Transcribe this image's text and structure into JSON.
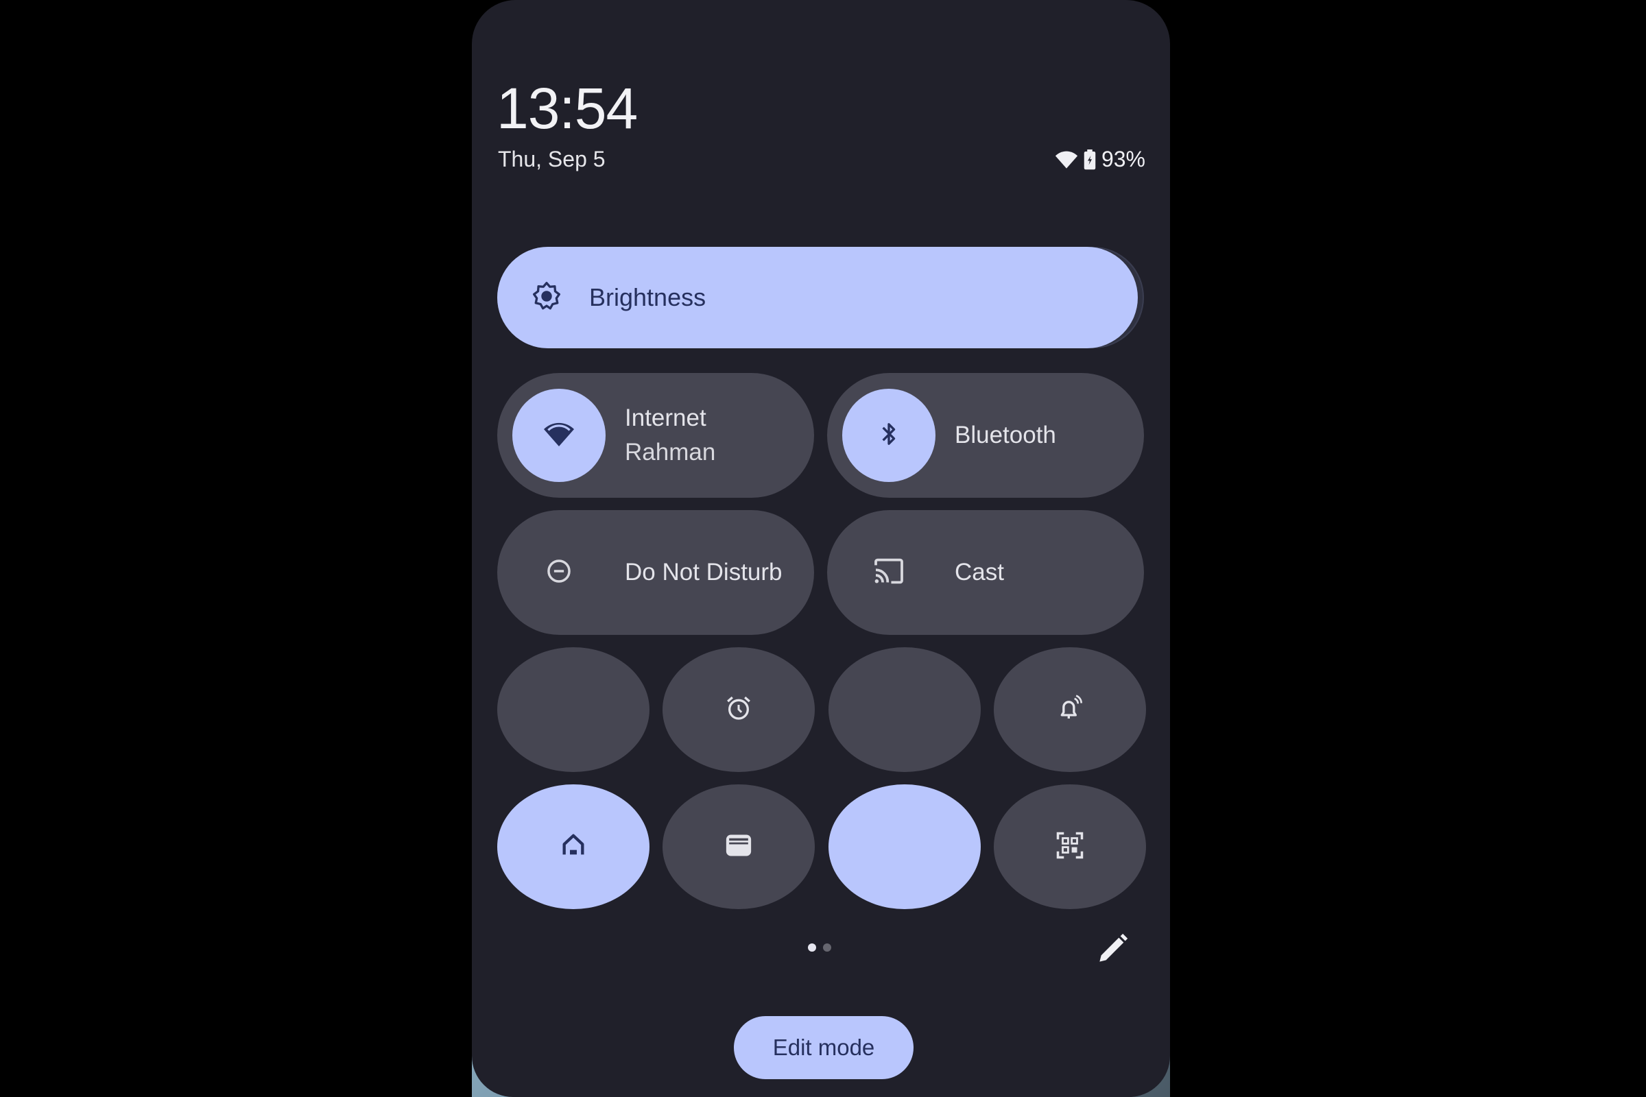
{
  "header": {
    "time": "13:54",
    "date": "Thu, Sep 5",
    "battery_percent": "93%",
    "status_icons": [
      "wifi-icon",
      "battery-icon"
    ]
  },
  "brightness": {
    "label": "Brightness",
    "icon": "brightness-icon",
    "level_percent": 99
  },
  "tiles_wide": [
    {
      "name": "internet",
      "title": "Internet",
      "subtitle": "Rahman",
      "icon": "wifi-icon",
      "active": true
    },
    {
      "name": "bluetooth",
      "title": "Bluetooth",
      "subtitle": "",
      "icon": "bluetooth-icon",
      "active": true
    },
    {
      "name": "do-not-disturb",
      "title": "Do Not Disturb",
      "subtitle": "",
      "icon": "do-not-disturb-icon",
      "active": false
    },
    {
      "name": "cast",
      "title": "Cast",
      "subtitle": "",
      "icon": "cast-icon",
      "active": false
    }
  ],
  "tiles_small": [
    {
      "name": "blank-1",
      "icon": "",
      "active": false
    },
    {
      "name": "alarm",
      "icon": "alarm-icon",
      "active": false
    },
    {
      "name": "blank-2",
      "icon": "",
      "active": false
    },
    {
      "name": "sound",
      "icon": "bell-ringing-icon",
      "active": false
    },
    {
      "name": "home",
      "icon": "home-icon",
      "active": true
    },
    {
      "name": "wallet",
      "icon": "wallet-icon",
      "active": false
    },
    {
      "name": "blank-3",
      "icon": "",
      "active": true
    },
    {
      "name": "qr-scanner",
      "icon": "qr-scan-icon",
      "active": false
    }
  ],
  "pagination": {
    "current": 1,
    "total": 2
  },
  "footer": {
    "edit_icon": "pencil-icon",
    "edit_mode_label": "Edit mode"
  },
  "colors": {
    "accent": "#b9c6fd",
    "accent_text": "#26305e",
    "tile_inactive": "#464652",
    "panel_bg": "#20202a"
  }
}
